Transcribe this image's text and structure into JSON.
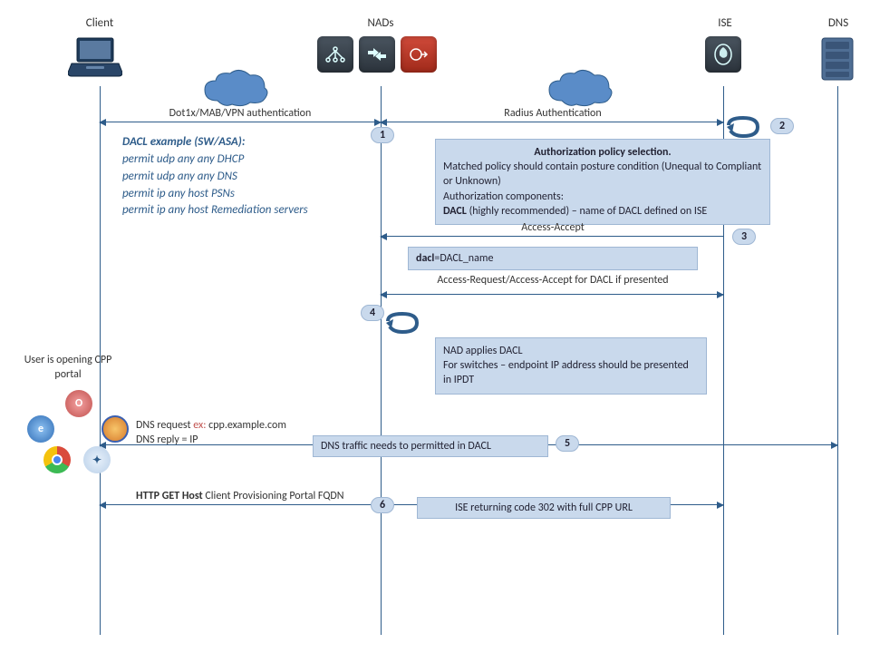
{
  "actors": {
    "client": "Client",
    "nads": "NADs",
    "ise": "ISE",
    "dns": "DNS"
  },
  "messages": {
    "auth_left": "Dot1x/MAB/VPN  authentication",
    "auth_right": "Radius Authentication",
    "access_accept": "Access-Accept",
    "dacl_box": "dacl=DACL_name",
    "access_request": "Access-Request/Access-Accept for DACL  if presented",
    "dns_request_pre": "DNS request ",
    "dns_request_ex": "ex:",
    "dns_request_post": " cpp.example.com",
    "dns_reply": "DNS reply = IP",
    "dns_traffic": "DNS traffic needs to permitted  in DACL",
    "http_get": "HTTP  GET Host Client Provisioning Portal FQDN",
    "ise_302": "ISE returning code 302 with full CPP URL"
  },
  "boxes": {
    "authz_title": "Authorization  policy selection.",
    "authz_l1": "Matched policy should contain posture condition (Unequal to Compliant or Unknown)",
    "authz_l2": "Authorization components:",
    "authz_l3_prefix": "DACL ",
    "authz_l3_rest": "(highly recommended) – name of DACL defined on ISE",
    "nad_applies_l1": "NAD applies DACL",
    "nad_applies_l2": "For switches – endpoint IP address should be presented  in IPDT"
  },
  "dacl": {
    "title": "DACL example (SW/ASA):",
    "l1": "permit udp any any  DHCP",
    "l2": "permit udp any any DNS",
    "l3": "permit ip any host PSNs",
    "l4": "permit ip any host Remediation servers"
  },
  "side": {
    "user_opening": "User is opening CPP portal"
  },
  "steps": {
    "s1": "1",
    "s2": "2",
    "s3": "3",
    "s4": "4",
    "s5": "5",
    "s6": "6"
  }
}
